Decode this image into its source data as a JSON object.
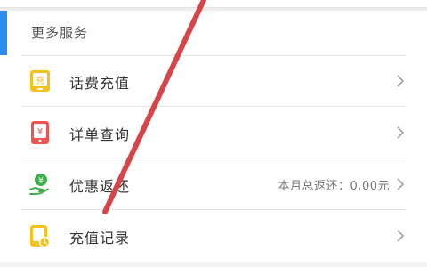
{
  "section": {
    "title": "更多服务",
    "accent_color": "#2d8cf0"
  },
  "items": [
    {
      "label": "话费充值",
      "icon": "recharge-card-icon",
      "value": ""
    },
    {
      "label": "详单查询",
      "icon": "phone-bill-icon",
      "value": ""
    },
    {
      "label": "优惠返还",
      "icon": "cashback-icon",
      "value": "本月总返还：0.00元"
    },
    {
      "label": "充值记录",
      "icon": "recharge-record-icon",
      "value": ""
    }
  ],
  "colors": {
    "icon_yellow": "#f4c21c",
    "icon_red": "#ef5350",
    "icon_green": "#3fae4a",
    "annotation_stroke": "#d64548"
  }
}
